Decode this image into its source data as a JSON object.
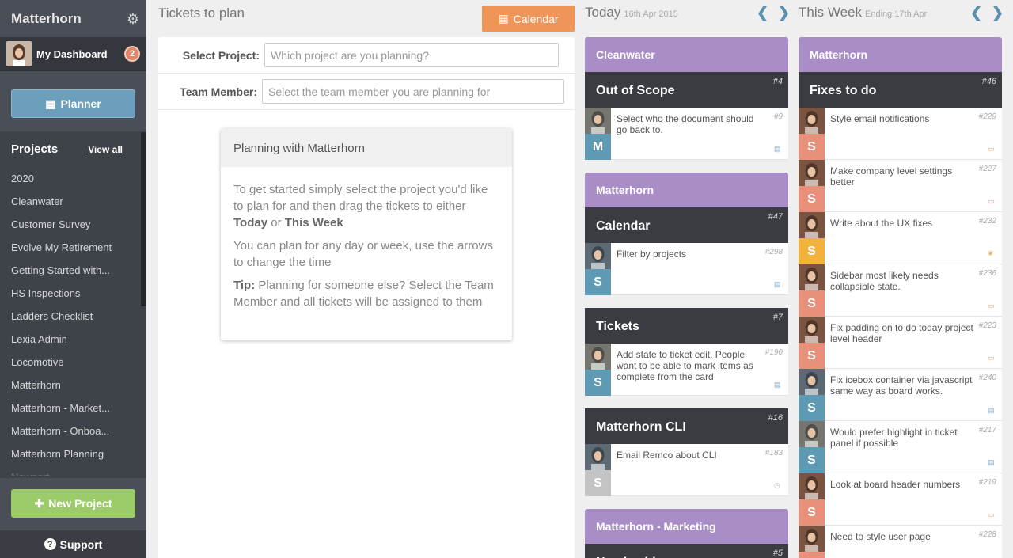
{
  "sidebar": {
    "title": "Matterhorn",
    "dashboard_label": "My Dashboard",
    "badge_count": "2",
    "planner_label": "Planner",
    "projects_label": "Projects",
    "view_all_label": "View all",
    "projects": [
      "2020",
      "Cleanwater",
      "Customer Survey",
      "Evolve My Retirement",
      "Getting Started with...",
      "HS Inspections",
      "Ladders Checklist",
      "Lexia Admin",
      "Locomotive",
      "Matterhorn",
      "Matterhorn - Market...",
      "Matterhorn - Onboa...",
      "Matterhorn Planning",
      "Newport"
    ],
    "new_project_label": "New Project",
    "support_label": "Support"
  },
  "plan": {
    "title": "Tickets to plan",
    "calendar_label": "Calendar",
    "select_project_label": "Select Project:",
    "select_project_placeholder": "Which project are you planning?",
    "team_member_label": "Team Member:",
    "team_member_placeholder": "Select the team member you are planning for",
    "info_title": "Planning with Matterhorn",
    "info_p1_a": "To get started simply select the project you'd like to plan for and then drag the tickets to either ",
    "info_p1_today": "Today",
    "info_p1_or": " or ",
    "info_p1_week": "This Week",
    "info_p2": "You can plan for any day or week, use the arrows to change the time",
    "info_tip_label": "Tip:",
    "info_tip": " Planning for someone else? Select the Team Member and all tickets will be assigned to them"
  },
  "today": {
    "title": "Today",
    "date": "16th Apr 2015",
    "groups": [
      {
        "project": "Cleanwater",
        "lists": [
          {
            "name": "Out of Scope",
            "num": "#4",
            "tickets": [
              {
                "text": "Select who the document should go back to.",
                "num": "#9",
                "letter": "M",
                "letter_color": "#5f9ab5",
                "photo": "m",
                "icon": "list"
              }
            ]
          }
        ]
      },
      {
        "project": "Matterhorn",
        "lists": [
          {
            "name": "Calendar",
            "num": "#47",
            "tickets": [
              {
                "text": "Filter by projects",
                "num": "#298",
                "letter": "S",
                "letter_color": "#5f9ab5",
                "photo": "b",
                "icon": "list"
              }
            ]
          },
          {
            "name": "Tickets",
            "num": "#7",
            "tickets": [
              {
                "text": "Add state to ticket edit. People want to be able to mark items as complete from the card",
                "num": "#190",
                "letter": "S",
                "letter_color": "#5f9ab5",
                "photo": "m",
                "icon": "list"
              }
            ]
          },
          {
            "name": "Matterhorn CLI",
            "num": "#16",
            "tickets": [
              {
                "text": "Email Remco about CLI",
                "num": "#183",
                "letter": "S",
                "letter_color": "#c4c4c4",
                "photo": "b",
                "icon": "clock"
              }
            ]
          }
        ]
      },
      {
        "project": "Matterhorn - Marketing",
        "lists": [
          {
            "name": "Needs video",
            "num": "#5",
            "tickets": []
          }
        ]
      }
    ]
  },
  "week": {
    "title": "This Week",
    "date": "Ending 17th Apr",
    "project": "Matterhorn",
    "list_name": "Fixes to do",
    "list_num": "#46",
    "tickets": [
      {
        "text": "Style email notifications",
        "num": "#229",
        "letter": "S",
        "letter_color": "#e8907a",
        "photo": "f",
        "icon": "image"
      },
      {
        "text": "Make company level settings better",
        "num": "#227",
        "letter": "S",
        "letter_color": "#e8907a",
        "photo": "f",
        "icon": "image"
      },
      {
        "text": "Write about the UX fixes",
        "num": "#232",
        "letter": "S",
        "letter_color": "#f2b33d",
        "photo": "f",
        "icon": "leaf"
      },
      {
        "text": "Sidebar most likely needs collapsible state.",
        "num": "#236",
        "letter": "S",
        "letter_color": "#e8907a",
        "photo": "f",
        "icon": "image"
      },
      {
        "text": "Fix padding on to do today project level header",
        "num": "#223",
        "letter": "S",
        "letter_color": "#e8907a",
        "photo": "f",
        "icon": "image"
      },
      {
        "text": "Fix icebox container via javascript same way as board works.",
        "num": "#240",
        "letter": "S",
        "letter_color": "#5f9ab5",
        "photo": "b",
        "icon": "list"
      },
      {
        "text": "Would prefer highlight in ticket panel if possible",
        "num": "#217",
        "letter": "S",
        "letter_color": "#5f9ab5",
        "photo": "m",
        "icon": "list"
      },
      {
        "text": "Look at board header numbers",
        "num": "#219",
        "letter": "S",
        "letter_color": "#e8907a",
        "photo": "f",
        "icon": "image"
      },
      {
        "text": "Need to style user page",
        "num": "#228",
        "letter": "S",
        "letter_color": "#e8907a",
        "photo": "f",
        "icon": "image"
      }
    ]
  },
  "colors": {
    "purple": "#a98dc7",
    "dark": "#3a3c42",
    "orange": "#f0955a",
    "blue": "#6b9fbc",
    "green": "#9ccc6a"
  }
}
